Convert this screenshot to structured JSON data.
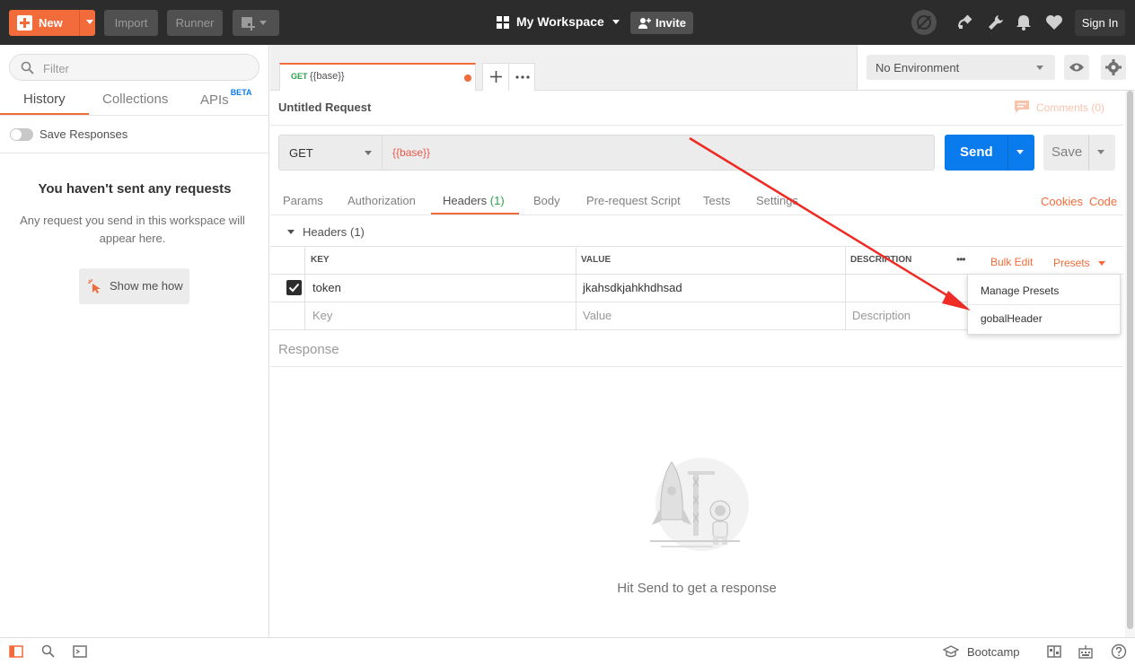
{
  "topbar": {
    "new_label": "New",
    "import_label": "Import",
    "runner_label": "Runner",
    "workspace_label": "My Workspace",
    "invite_label": "Invite",
    "signin_label": "Sign In"
  },
  "sidebar": {
    "filter_placeholder": "Filter",
    "tabs": [
      {
        "label": "History"
      },
      {
        "label": "Collections"
      },
      {
        "label": "APIs",
        "badge": "BETA"
      }
    ],
    "save_responses_label": "Save Responses",
    "empty_title": "You haven't sent any requests",
    "empty_desc": "Any request you send in this workspace will appear here.",
    "show_me_label": "Show me how"
  },
  "request_tab": {
    "method": "GET",
    "url": "{{base}}"
  },
  "environment": {
    "selected": "No Environment"
  },
  "request": {
    "title": "Untitled Request",
    "comments_label": "Comments (0)",
    "method": "GET",
    "url": "{{base}}",
    "send_label": "Send",
    "save_label": "Save",
    "tabs": [
      {
        "label": "Params"
      },
      {
        "label": "Authorization"
      },
      {
        "label": "Headers",
        "count": "(1)"
      },
      {
        "label": "Body"
      },
      {
        "label": "Pre-request Script"
      },
      {
        "label": "Tests"
      },
      {
        "label": "Settings"
      }
    ],
    "cookies_label": "Cookies",
    "code_label": "Code"
  },
  "headers": {
    "section_label": "Headers",
    "section_count": "(1)",
    "columns": [
      "KEY",
      "VALUE",
      "DESCRIPTION"
    ],
    "more_label": "•••",
    "bulk_edit_label": "Bulk Edit",
    "presets_label": "Presets",
    "rows": [
      {
        "key": "token",
        "value": "jkahsdkjahkhdhsad",
        "description": ""
      }
    ],
    "placeholder_row": {
      "key": "Key",
      "value": "Value",
      "description": "Description"
    }
  },
  "presets_dropdown": {
    "items": [
      "Manage Presets",
      "gobalHeader"
    ]
  },
  "response": {
    "label": "Response",
    "empty_message": "Hit Send to get a response"
  },
  "statusbar": {
    "bootcamp_label": "Bootcamp"
  },
  "colors": {
    "accent": "#f26b3a",
    "send_blue": "#097bed",
    "topbar_bg": "#2c2c2c",
    "annotation_arrow": "#ee2b24"
  }
}
